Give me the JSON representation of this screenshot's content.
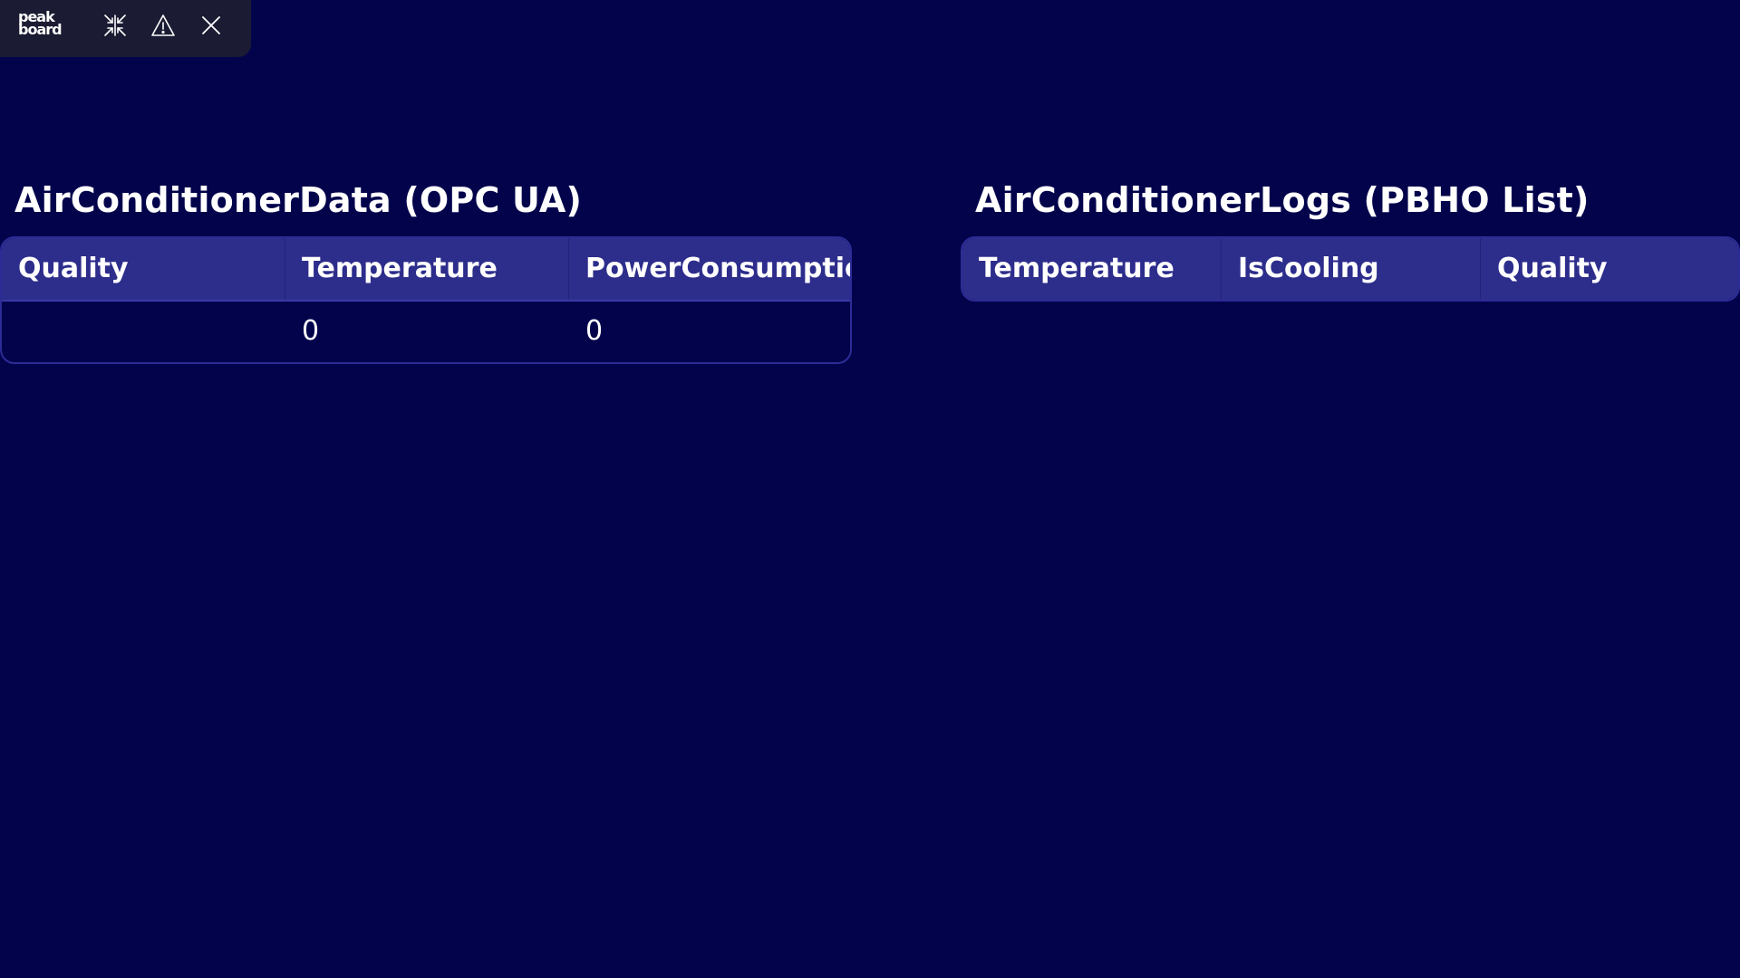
{
  "colors": {
    "background": "#03034c",
    "toolbar": "#1b1b33",
    "table_header": "#2d2d8c",
    "table_border": "#2c2c96",
    "text": "#ffffff"
  },
  "toolbar": {
    "logo_line1": "peak",
    "logo_line2": "board",
    "icons": [
      "collapse-icon",
      "warning-icon",
      "close-icon"
    ]
  },
  "left_panel": {
    "title": "AirConditionerData (OPC UA)",
    "columns": [
      "Quality",
      "Temperature",
      "PowerConsumptio"
    ],
    "rows": [
      [
        "",
        "0",
        "0"
      ]
    ]
  },
  "right_panel": {
    "title": "AirConditionerLogs (PBHO List)",
    "columns": [
      "Temperature",
      "IsCooling",
      "Quality"
    ],
    "rows": []
  }
}
